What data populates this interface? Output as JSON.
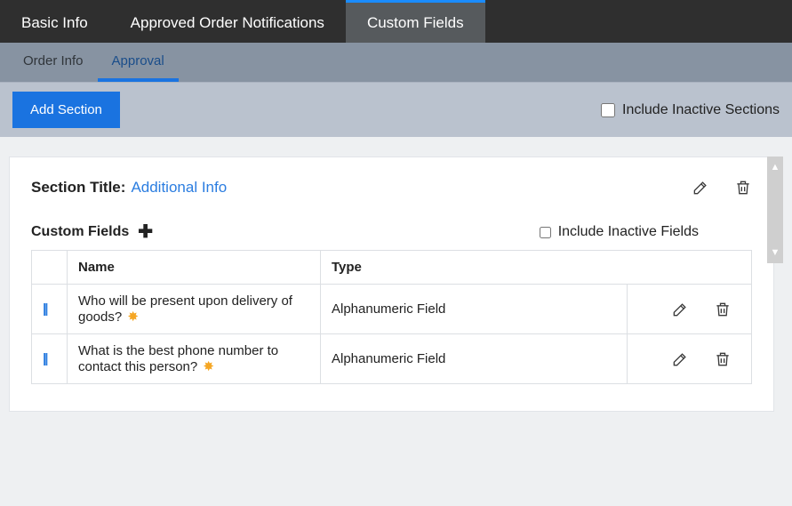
{
  "top_tabs": {
    "basic_info": "Basic Info",
    "approved_notifications": "Approved Order Notifications",
    "custom_fields": "Custom Fields"
  },
  "sub_tabs": {
    "order_info": "Order Info",
    "approval": "Approval"
  },
  "action_bar": {
    "add_section": "Add Section",
    "include_inactive_sections": "Include Inactive Sections"
  },
  "section": {
    "title_label": "Section Title:",
    "title_value": "Additional Info",
    "custom_fields_label": "Custom Fields",
    "include_inactive_fields": "Include Inactive Fields"
  },
  "table": {
    "headers": {
      "name": "Name",
      "type": "Type"
    },
    "rows": [
      {
        "name": "Who will be present upon delivery of goods?",
        "type": "Alphanumeric Field",
        "required": true
      },
      {
        "name": "What is the best phone number to contact this person?",
        "type": "Alphanumeric Field",
        "required": true
      }
    ]
  },
  "icons": {
    "edit": "edit-icon",
    "delete": "trash-icon",
    "add": "plus-icon",
    "drag": "drag-handle-icon",
    "required": "required-star-icon"
  }
}
